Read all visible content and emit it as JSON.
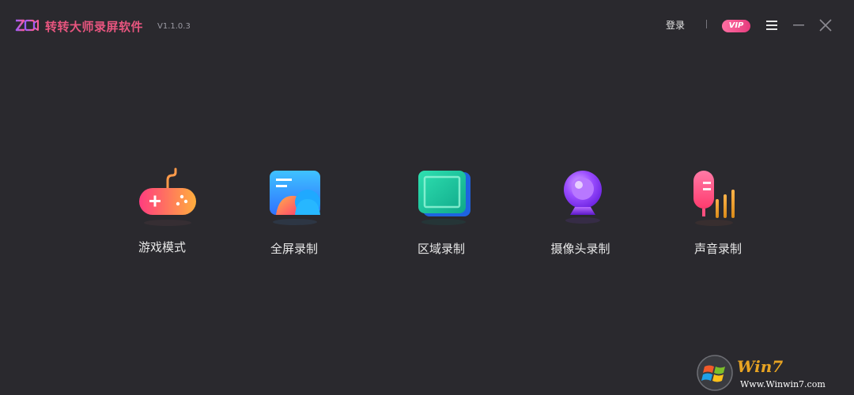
{
  "app": {
    "title": "转转大师录屏软件",
    "version": "V1.1.0.3",
    "brand_color": "#e8557f"
  },
  "header": {
    "login_label": "登录",
    "vip_label": "VIP",
    "icons": [
      "menu-icon",
      "minimize-icon",
      "close-icon"
    ]
  },
  "modes": [
    {
      "label": "游戏模式",
      "icon": "gamepad-icon"
    },
    {
      "label": "全屏录制",
      "icon": "fullscreen-icon"
    },
    {
      "label": "区域录制",
      "icon": "region-icon"
    },
    {
      "label": "摄像头录制",
      "icon": "camera-icon"
    },
    {
      "label": "声音录制",
      "icon": "microphone-icon"
    }
  ],
  "watermark": {
    "title": "Win7",
    "url": "Www.Winwin7.com"
  },
  "colors": {
    "background": "#2a292e",
    "vip": "#e63b7d"
  }
}
